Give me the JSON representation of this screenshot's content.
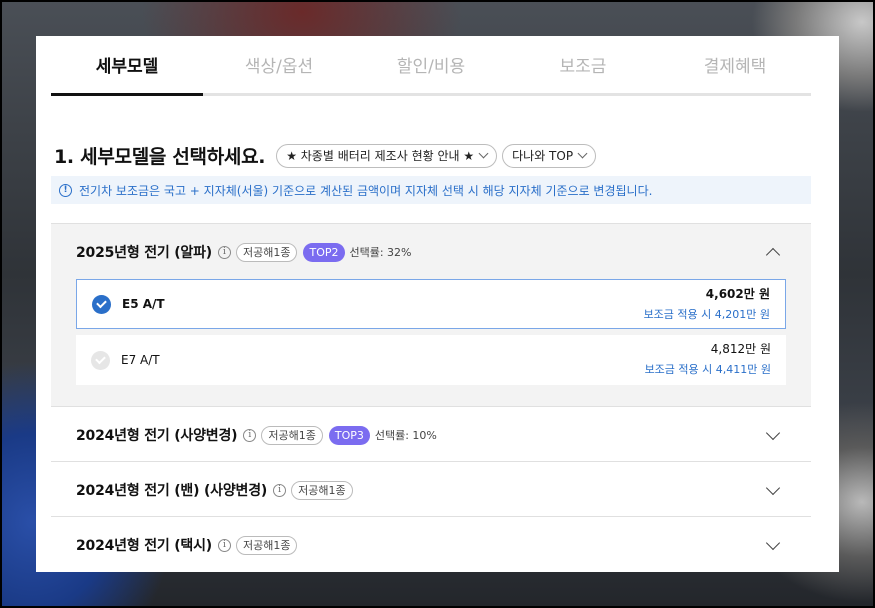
{
  "tabs": [
    {
      "label": "세부모델",
      "active": true
    },
    {
      "label": "색상/옵션",
      "active": false
    },
    {
      "label": "할인/비용",
      "active": false
    },
    {
      "label": "보조금",
      "active": false
    },
    {
      "label": "결제혜택",
      "active": false
    }
  ],
  "heading": {
    "title": "1. 세부모델을 선택하세요.",
    "battery_pill": "★ 차종별 배터리 제조사 현황 안내 ★",
    "region_pill": "다나와 TOP"
  },
  "notice": {
    "icon": "info-icon",
    "text": "전기차 보조금은 국고 + 지자체(서울) 기준으로 계산된 금액이며 지자체 선택 시 해당 지자체 기준으로 변경됩니다."
  },
  "groups": [
    {
      "title": "2025년형 전기 (알파)",
      "info_glyph": "i",
      "tag": "저공해1종",
      "top_badge": "TOP2",
      "rate": "선택률: 32%",
      "expanded": true,
      "models": [
        {
          "name": "E5 A/T",
          "price": "4,602만 원",
          "subsidy": "보조금 적용 시 4,201만 원",
          "selected": true
        },
        {
          "name": "E7 A/T",
          "price": "4,812만 원",
          "subsidy": "보조금 적용 시 4,411만 원",
          "selected": false
        }
      ]
    },
    {
      "title": "2024년형 전기 (사양변경)",
      "info_glyph": "i",
      "tag": "저공해1종",
      "top_badge": "TOP3",
      "rate": "선택률: 10%",
      "expanded": false
    },
    {
      "title": "2024년형 전기 (밴) (사양변경)",
      "info_glyph": "i",
      "tag": "저공해1종",
      "expanded": false
    },
    {
      "title": "2024년형 전기 (택시)",
      "info_glyph": "i",
      "tag": "저공해1종",
      "expanded": false
    }
  ],
  "colors": {
    "accent_blue": "#2a6fc9",
    "top_badge": "#7b6cf0",
    "notice_bg": "#eef4fb",
    "expanded_bg": "#f3f3f3"
  }
}
